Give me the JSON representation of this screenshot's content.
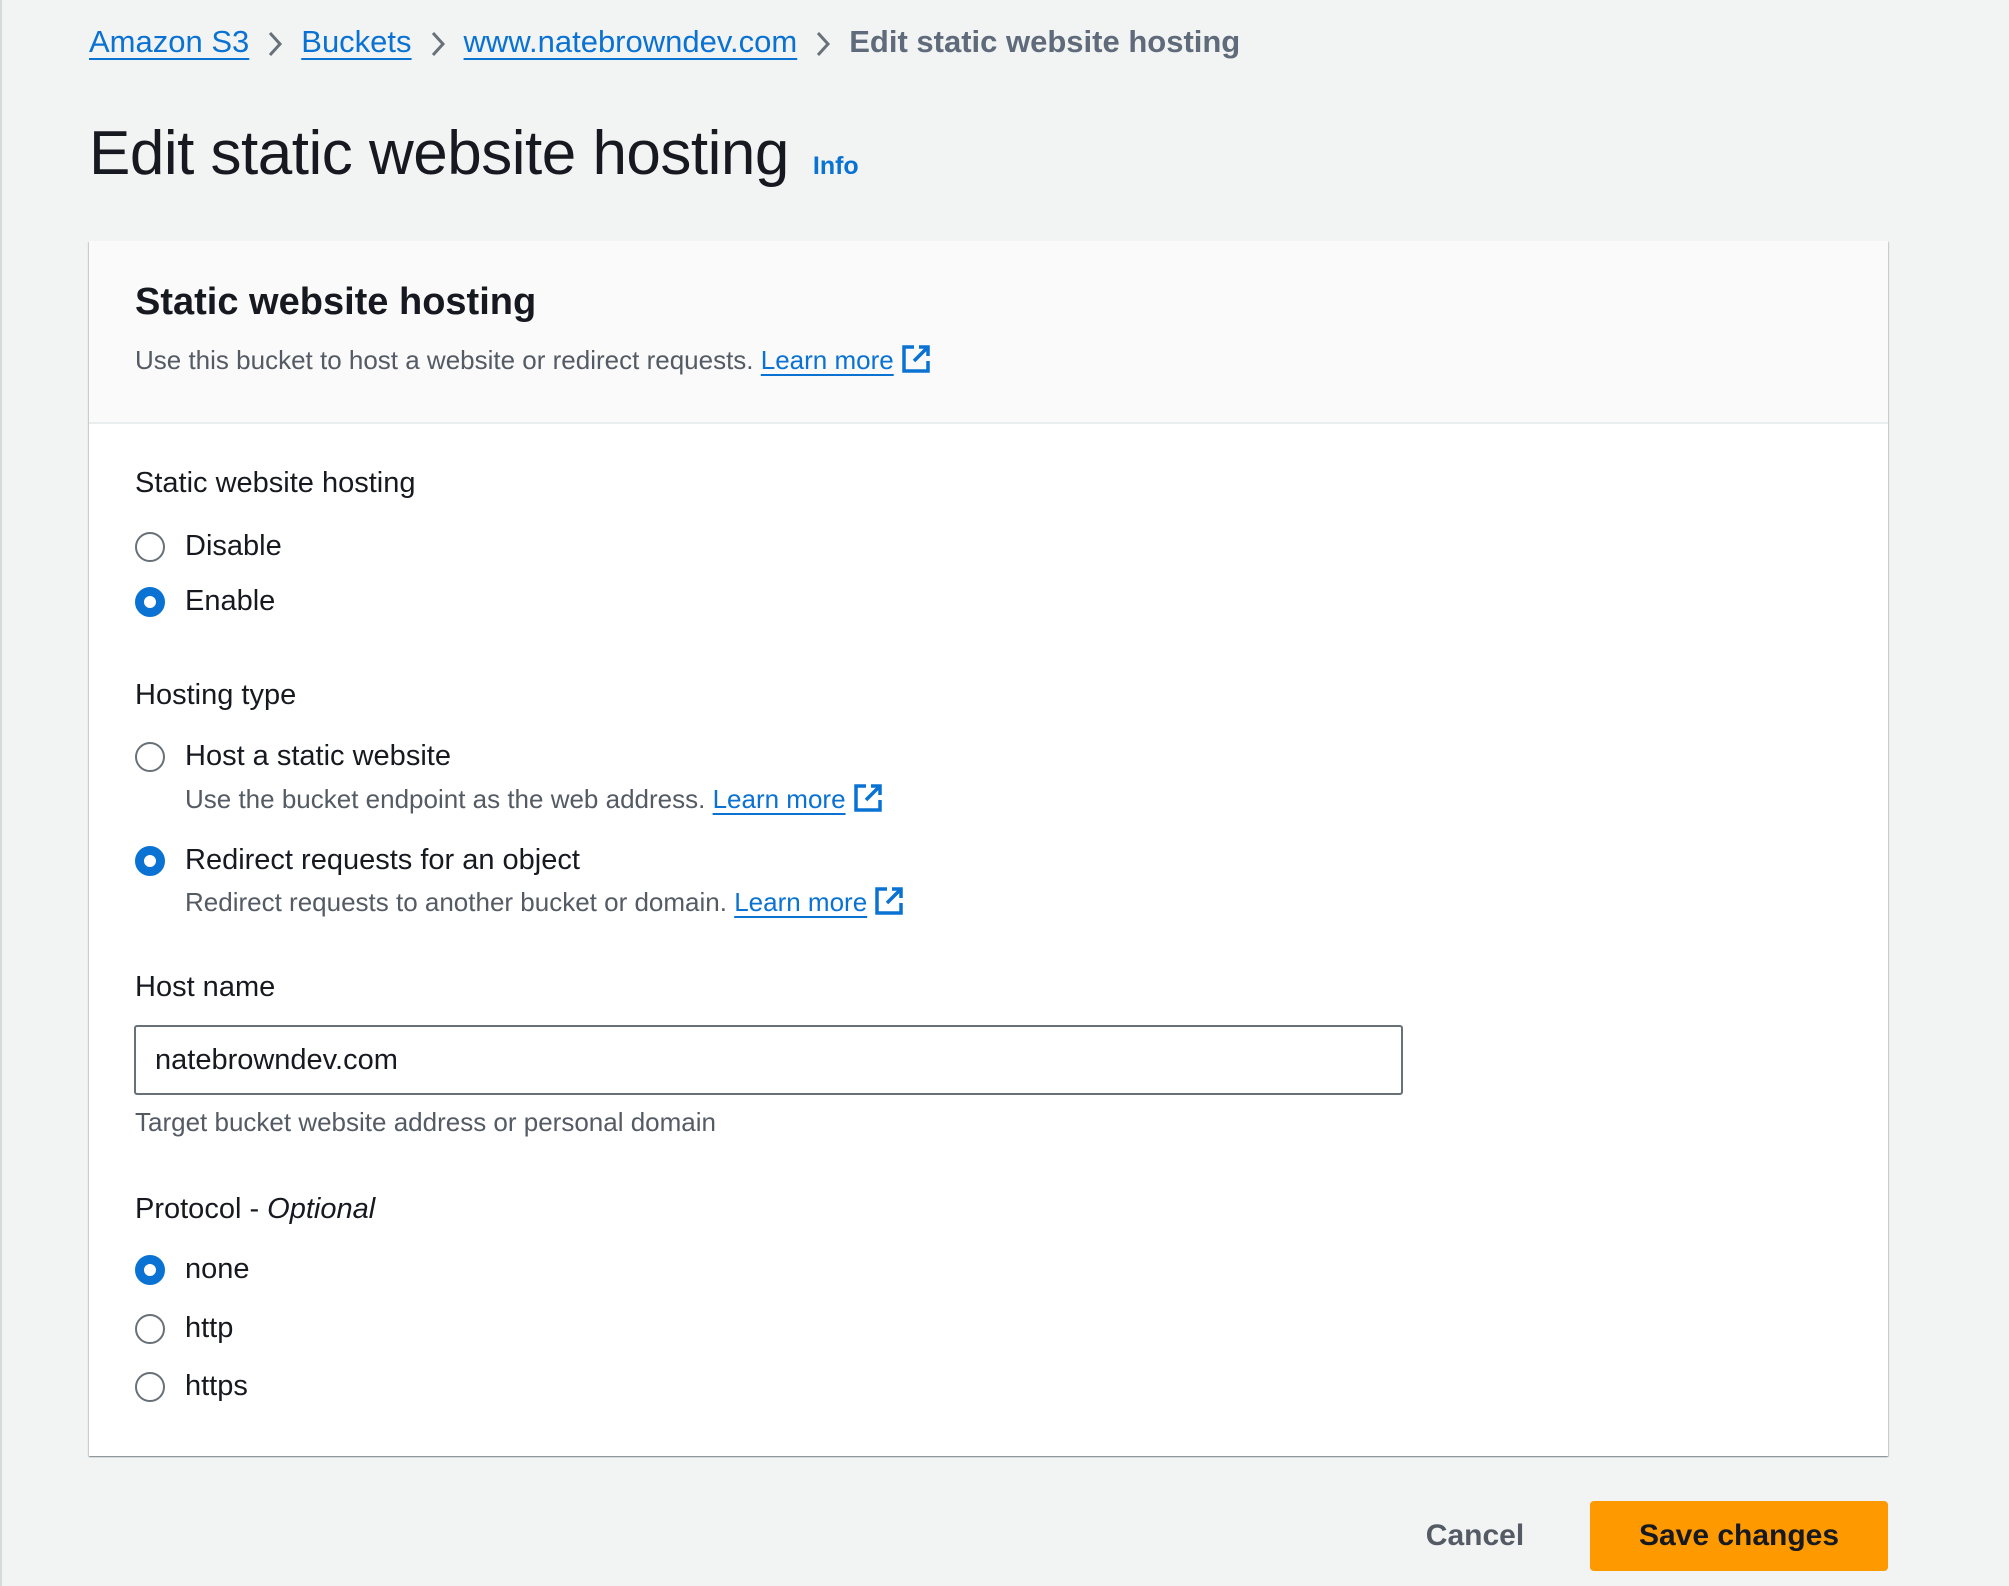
{
  "breadcrumb": {
    "items": [
      {
        "label": "Amazon S3"
      },
      {
        "label": "Buckets"
      },
      {
        "label": "www.natebrowndev.com"
      }
    ],
    "current": "Edit static website hosting",
    "separator_icon": "chevron-right-icon"
  },
  "page": {
    "title": "Edit static website hosting",
    "info_link": "Info"
  },
  "card": {
    "title": "Static website hosting",
    "description": "Use this bucket to host a website or redirect requests.",
    "learn_more": "Learn more",
    "external_icon": "external-link-icon"
  },
  "hosting": {
    "label": "Static website hosting",
    "options": [
      {
        "label": "Disable",
        "checked": false
      },
      {
        "label": "Enable",
        "checked": true
      }
    ]
  },
  "hosting_type": {
    "label": "Hosting type",
    "options": [
      {
        "label": "Host a static website",
        "description": "Use the bucket endpoint as the web address.",
        "learn_more": "Learn more",
        "checked": false
      },
      {
        "label": "Redirect requests for an object",
        "description": "Redirect requests to another bucket or domain.",
        "learn_more": "Learn more",
        "checked": true
      }
    ]
  },
  "host_name": {
    "label": "Host name",
    "value": "natebrowndev.com",
    "hint": "Target bucket website address or personal domain"
  },
  "protocol": {
    "label": "Protocol - ",
    "optional": "Optional",
    "options": [
      {
        "label": "none",
        "checked": true
      },
      {
        "label": "http",
        "checked": false
      },
      {
        "label": "https",
        "checked": false
      }
    ]
  },
  "actions": {
    "cancel": "Cancel",
    "save": "Save changes"
  },
  "colors": {
    "link": "#0972d3",
    "primary_button": "#ff9900",
    "background": "#f2f3f3",
    "text": "#16191f",
    "secondary_text": "#545b64"
  }
}
